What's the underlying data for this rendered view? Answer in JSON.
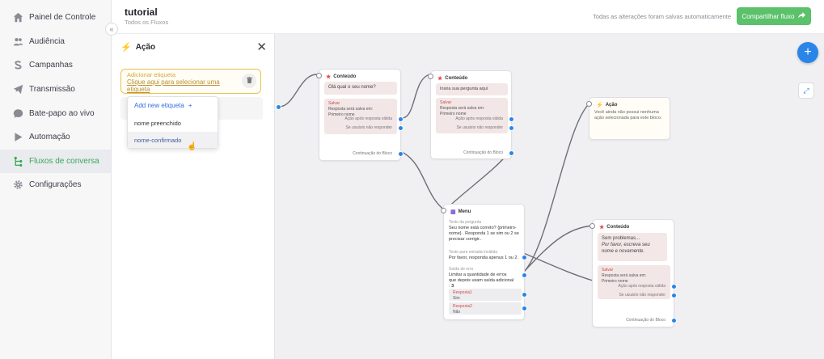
{
  "sidebar": {
    "items": [
      {
        "label": "Painel de Controle",
        "icon": "home-icon"
      },
      {
        "label": "Audiência",
        "icon": "users-icon"
      },
      {
        "label": "Campanhas",
        "icon": "campaign-icon"
      },
      {
        "label": "Transmissão",
        "icon": "broadcast-icon"
      },
      {
        "label": "Bate-papo ao vivo",
        "icon": "chat-icon"
      },
      {
        "label": "Automação",
        "icon": "play-icon"
      },
      {
        "label": "Fluxos de conversa",
        "icon": "flow-icon"
      },
      {
        "label": "Configurações",
        "icon": "gear-icon"
      }
    ],
    "active_index": 6,
    "collapse_glyph": "«"
  },
  "header": {
    "title": "tutorial",
    "breadcrumb": "Todos os Fluxos",
    "saved_status": "Todas as alterações foram salvas automaticamente",
    "share_label": "Compartilhar fluxo"
  },
  "panel": {
    "title": "Ação",
    "tag_label": "Adicionar etiqueta",
    "tag_hint": "Clique aqui para selecionar uma etiqueta",
    "dropdown": {
      "add_label": "Add new etiqueta",
      "add_glyph": "+",
      "options": [
        "nome preenchido",
        "nome-confirmado"
      ]
    }
  },
  "nodes": {
    "content1": {
      "title": "Conteúdo",
      "message": "Olá qual o seu nome?",
      "save_title": "Salvar",
      "save_line1": "Resposta será salva em:",
      "save_field": "Primeiro nome",
      "valid_label": "Ação após resposta válida",
      "no_response_label": "Se usuário não responder",
      "continue_label": "Continuação do Bloco"
    },
    "content2": {
      "title": "Conteúdo",
      "message": "Insira sua pergunta aqui",
      "save_title": "Salvar",
      "save_line1": "Resposta será salva em:",
      "save_field": "Primeiro nome",
      "valid_label": "Ação após resposta válida",
      "no_response_label": "Se usuário não responder",
      "continue_label": "Continuação do Bloco"
    },
    "action": {
      "title": "Ação",
      "text": "Você ainda não possui nenhuma ação selecionada para este bloco."
    },
    "menu": {
      "title": "Menu",
      "question_label": "Texto da pergunta",
      "question_text": "Seu nome está correto? {primeiro-nome} . Responda 1 se sim ou 2 se precisar corrigir..",
      "invalid_label": "Texto para entrada inválida",
      "invalid_text": "Por favor, responda apenus 1 ou 2.",
      "error_label": "Saída de erro",
      "error_text": "Limitar a quantidade de erros que depois usam saída adicional :",
      "error_count": "3",
      "resp1_label": "Resposta1",
      "resp1_value": "Sim",
      "resp2_label": "Resposta2",
      "resp2_value": "Não"
    },
    "content3": {
      "title": "Conteúdo",
      "message_line1": "Sem problemas...",
      "message_line2": "Por favor, escreva seu nome e novamente.",
      "save_title": "Salvar",
      "save_line1": "Resposta será salva em:",
      "save_field": "Primeiro nome",
      "valid_label": "Ação após resposta válida",
      "no_response_label": "Se usuário não responder",
      "continue_label": "Continuação do Bloco"
    }
  },
  "canvas_controls": {
    "add_glyph": "+",
    "fit_glyph": "⤢"
  }
}
